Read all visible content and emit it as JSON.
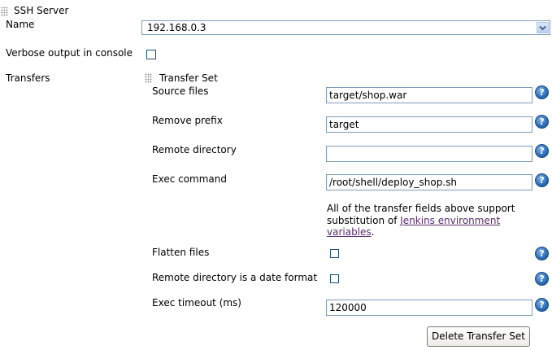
{
  "ssh_server": {
    "section_label": "SSH Server",
    "name_label": "Name",
    "name_value": "192.168.0.3",
    "verbose_label": "Verbose output in console",
    "verbose_checked": false
  },
  "transfers": {
    "label": "Transfers",
    "set_label": "Transfer Set",
    "source_files": {
      "label": "Source files",
      "value": "target/shop.war"
    },
    "remove_prefix": {
      "label": "Remove prefix",
      "value": "target"
    },
    "remote_directory": {
      "label": "Remote directory",
      "value": ""
    },
    "exec_command": {
      "label": "Exec command",
      "value": "/root/shell/deploy_shop.sh"
    },
    "note": {
      "before": "All of the transfer fields above support substitution of ",
      "link": "Jenkins environment variables",
      "after": "."
    },
    "flatten_files": {
      "label": "Flatten files",
      "checked": false
    },
    "date_format": {
      "label": "Remote directory is a date format",
      "checked": false
    },
    "exec_timeout": {
      "label": "Exec timeout (ms)",
      "value": "120000"
    },
    "delete_button": "Delete Transfer Set"
  },
  "icons": {
    "help": "help-icon",
    "help_glyph": "?",
    "dropdown": "chevron-down-icon",
    "grip": "drag-handle-icon"
  }
}
